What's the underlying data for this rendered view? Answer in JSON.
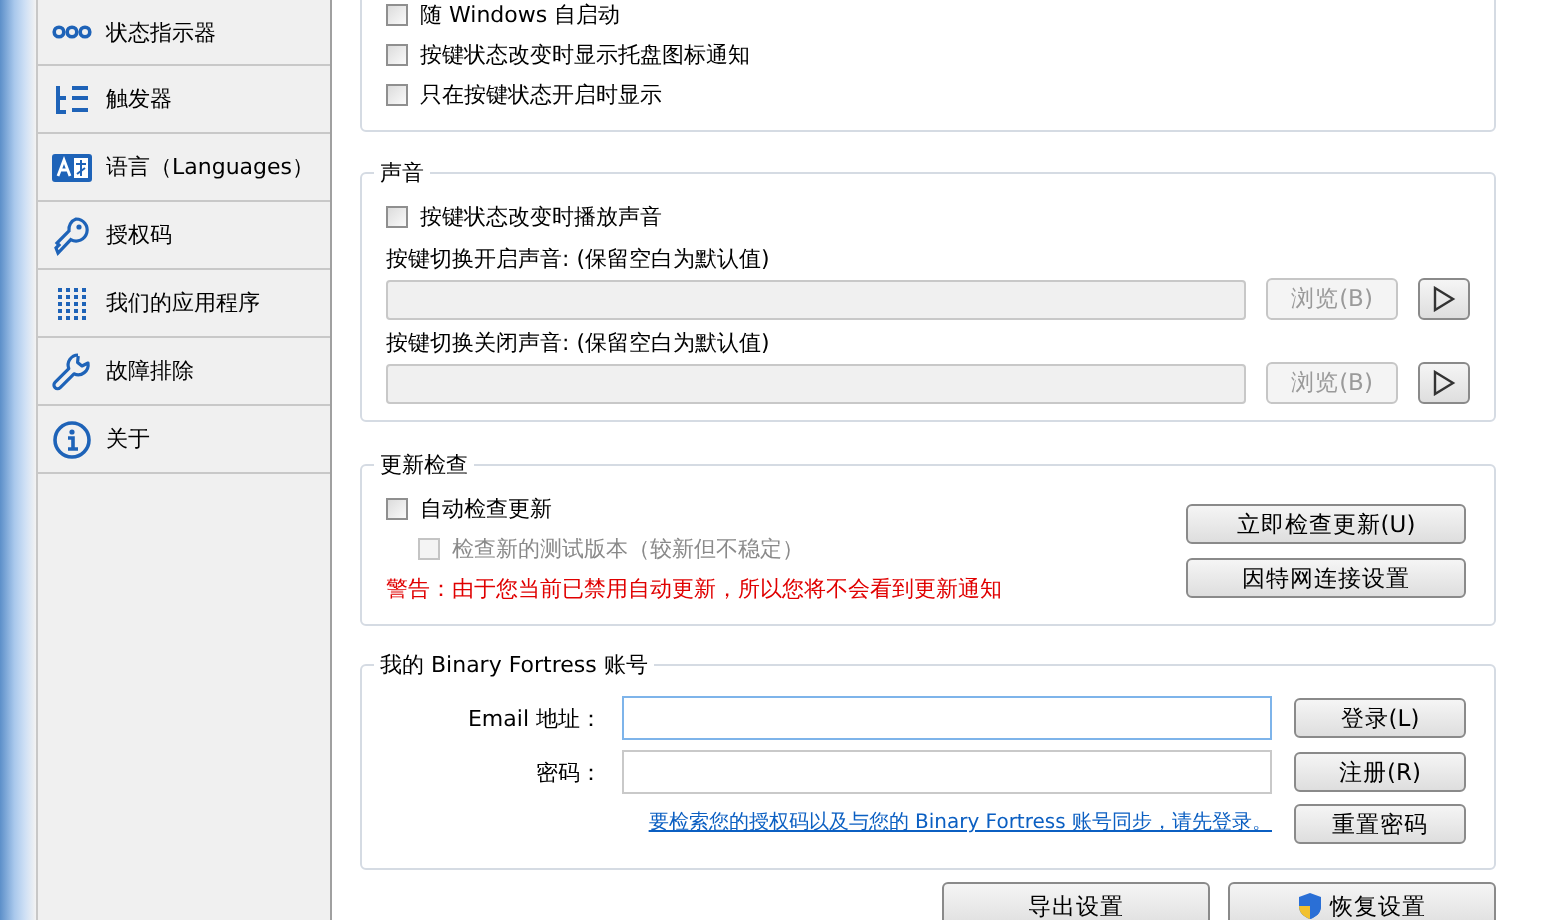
{
  "sidebar": {
    "items": [
      {
        "label": "状态指示器",
        "kind": "dots"
      },
      {
        "label": "触发器",
        "kind": "tree"
      },
      {
        "label": "语言（Languages）",
        "kind": "language"
      },
      {
        "label": "授权码",
        "kind": "key"
      },
      {
        "label": "我们的应用程序",
        "kind": "grid"
      },
      {
        "label": "故障排除",
        "kind": "wrench"
      },
      {
        "label": "关于",
        "kind": "info"
      }
    ]
  },
  "general": {
    "checkboxes": [
      {
        "label": "随 Windows 自启动",
        "checked": false
      },
      {
        "label": "按键状态改变时显示托盘图标通知",
        "checked": false
      },
      {
        "label": "只在按键状态开启时显示",
        "checked": false
      }
    ]
  },
  "sound": {
    "title": "声音",
    "checkbox": {
      "label": "按键状态改变时播放声音",
      "checked": false
    },
    "files": [
      {
        "label": "按键切换开启声音: (保留空白为默认值)",
        "browse": "浏览(B)",
        "disabled": true
      },
      {
        "label": "按键切换关闭声音: (保留空白为默认值)",
        "browse": "浏览(B)",
        "disabled": true
      }
    ]
  },
  "update": {
    "title": "更新检查",
    "checkbox": {
      "label": "自动检查更新",
      "checked": false,
      "disabled": false
    },
    "sub_checkbox": {
      "label": "检查新的测试版本（较新但不稳定）",
      "checked": false,
      "disabled": true
    },
    "warning": "警告：由于您当前已禁用自动更新，所以您将不会看到更新通知",
    "buttons": [
      "立即检查更新(U)",
      "因特网连接设置"
    ]
  },
  "account": {
    "title": "我的 Binary Fortress 账号",
    "fields": [
      {
        "label": "Email 地址：",
        "focused": true
      },
      {
        "label": "密码：",
        "focused": false
      }
    ],
    "link": "要检索您的授权码以及与您的 Binary Fortress 账号同步，请先登录。",
    "buttons": [
      "登录(L)",
      "注册(R)",
      "重置密码"
    ]
  },
  "footer": {
    "buttons": [
      {
        "label": "导出设置",
        "shield": false
      },
      {
        "label": "恢复设置",
        "shield": true
      }
    ]
  }
}
